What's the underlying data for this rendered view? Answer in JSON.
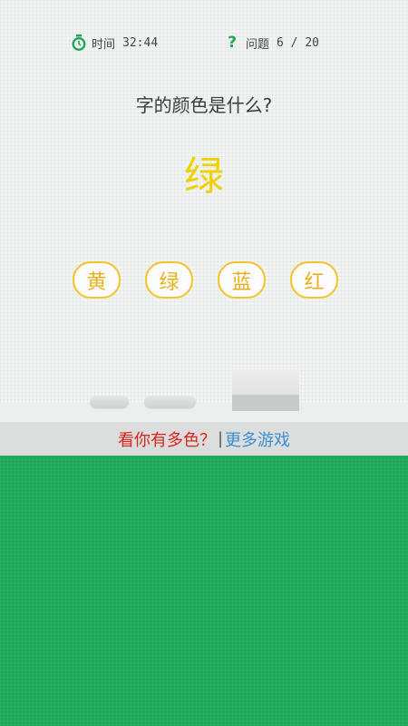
{
  "status": {
    "time_label": "时间",
    "time_value": "32:44",
    "question_label": "问题",
    "question_progress": "6 / 20"
  },
  "question": {
    "prompt": "字的颜色是什么?",
    "word": "绿",
    "word_color": "#f0d000"
  },
  "options": [
    {
      "label": "黄"
    },
    {
      "label": "绿"
    },
    {
      "label": "蓝"
    },
    {
      "label": "红"
    }
  ],
  "banner": {
    "left_text": "看你有多色？",
    "separator": "|",
    "right_text": "更多游戏"
  },
  "colors": {
    "accent_green": "#1fa85a",
    "option_border": "#f3c32b",
    "banner_red": "#d8261b",
    "banner_blue": "#3a8fd0"
  },
  "icons": {
    "timer": "clock-icon",
    "question": "question-mark-icon"
  }
}
